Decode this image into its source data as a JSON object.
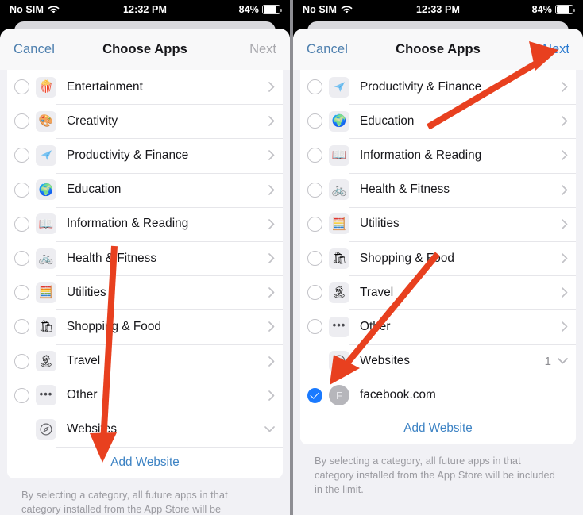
{
  "panels": [
    {
      "id": "left",
      "statusbar": {
        "carrier": "No SIM",
        "wifi_icon": "wifi-icon",
        "time": "12:32 PM",
        "battery_percent": "84%",
        "battery_icon": "battery-icon"
      },
      "navbar": {
        "cancel_label": "Cancel",
        "title": "Choose Apps",
        "next_label": "Next",
        "next_enabled": false
      },
      "rows": [
        {
          "label": "Entertainment",
          "icon": "popcorn-icon",
          "glyph": "🍿",
          "selectable": true,
          "chevron": "chevron-right-icon"
        },
        {
          "label": "Creativity",
          "icon": "palette-icon",
          "glyph": "🎨",
          "selectable": true,
          "chevron": "chevron-right-icon"
        },
        {
          "label": "Productivity & Finance",
          "icon": "paper-plane-icon",
          "glyph": "✈",
          "selectable": true,
          "chevron": "chevron-right-icon"
        },
        {
          "label": "Education",
          "icon": "globe-icon",
          "glyph": "🌍",
          "selectable": true,
          "chevron": "chevron-right-icon"
        },
        {
          "label": "Information & Reading",
          "icon": "open-book-icon",
          "glyph": "📖",
          "selectable": true,
          "chevron": "chevron-right-icon"
        },
        {
          "label": "Health & Fitness",
          "icon": "bicycle-icon",
          "glyph": "🚲",
          "selectable": true,
          "chevron": "chevron-right-icon"
        },
        {
          "label": "Utilities",
          "icon": "calculator-icon",
          "glyph": "🗒",
          "selectable": true,
          "chevron": "chevron-right-icon"
        },
        {
          "label": "Shopping & Food",
          "icon": "shopping-bag-icon",
          "glyph": "🛍",
          "selectable": true,
          "chevron": "chevron-right-icon"
        },
        {
          "label": "Travel",
          "icon": "palm-island-icon",
          "glyph": "🏝",
          "selectable": true,
          "chevron": "chevron-right-icon"
        },
        {
          "label": "Other",
          "icon": "ellipsis-icon",
          "glyph": "•••",
          "selectable": true,
          "chevron": "chevron-right-icon"
        },
        {
          "label": "Websites",
          "icon": "compass-icon",
          "glyph": "compass",
          "selectable": false,
          "chevron": "chevron-down-icon"
        }
      ],
      "add_website_label": "Add Website",
      "footnote": "By selecting a category, all future apps in that category installed from the App Store will be"
    },
    {
      "id": "right",
      "statusbar": {
        "carrier": "No SIM",
        "wifi_icon": "wifi-icon",
        "time": "12:33 PM",
        "battery_percent": "84%",
        "battery_icon": "battery-icon"
      },
      "navbar": {
        "cancel_label": "Cancel",
        "title": "Choose Apps",
        "next_label": "Next",
        "next_enabled": true
      },
      "rows": [
        {
          "label": "Productivity & Finance",
          "icon": "paper-plane-icon",
          "glyph": "✈",
          "selectable": true,
          "chevron": "chevron-right-icon"
        },
        {
          "label": "Education",
          "icon": "globe-icon",
          "glyph": "🌍",
          "selectable": true,
          "chevron": "chevron-right-icon"
        },
        {
          "label": "Information & Reading",
          "icon": "open-book-icon",
          "glyph": "📖",
          "selectable": true,
          "chevron": "chevron-right-icon"
        },
        {
          "label": "Health & Fitness",
          "icon": "bicycle-icon",
          "glyph": "🚲",
          "selectable": true,
          "chevron": "chevron-right-icon"
        },
        {
          "label": "Utilities",
          "icon": "calculator-icon",
          "glyph": "🗒",
          "selectable": true,
          "chevron": "chevron-right-icon"
        },
        {
          "label": "Shopping & Food",
          "icon": "shopping-bag-icon",
          "glyph": "🛍",
          "selectable": true,
          "chevron": "chevron-right-icon"
        },
        {
          "label": "Travel",
          "icon": "palm-island-icon",
          "glyph": "🏝",
          "selectable": true,
          "chevron": "chevron-right-icon"
        },
        {
          "label": "Other",
          "icon": "ellipsis-icon",
          "glyph": "•••",
          "selectable": true,
          "chevron": "chevron-right-icon"
        },
        {
          "label": "Websites",
          "icon": "compass-icon",
          "glyph": "compass",
          "selectable": false,
          "chevron": "chevron-down-icon",
          "count": "1"
        },
        {
          "label": "facebook.com",
          "icon": "facebook-avatar",
          "glyph": "F",
          "checked": true
        }
      ],
      "add_website_label": "Add Website",
      "footnote": "By selecting a category, all future apps in that category installed from the App Store will be included in the limit."
    }
  ],
  "annotations": {
    "arrow_color": "#e8401f",
    "left_arrow": {
      "label": "arrow-to-add-website"
    },
    "right_arrow_next": {
      "label": "arrow-to-next-button"
    },
    "right_arrow_website": {
      "label": "arrow-to-facebook-row"
    }
  }
}
